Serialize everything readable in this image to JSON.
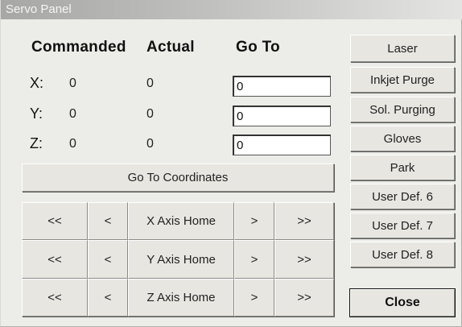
{
  "window": {
    "title": "Servo Panel"
  },
  "headers": {
    "commanded": "Commanded",
    "actual": "Actual",
    "goto": "Go To"
  },
  "axes": [
    {
      "label": "X:",
      "commanded": "0",
      "actual": "0",
      "goto": "0"
    },
    {
      "label": "Y:",
      "commanded": "0",
      "actual": "0",
      "goto": "0"
    },
    {
      "label": "Z:",
      "commanded": "0",
      "actual": "0",
      "goto": "0"
    }
  ],
  "go_to_coordinates_label": "Go To Coordinates",
  "jog": {
    "fast_neg": "<<",
    "slow_neg": "<",
    "slow_pos": ">",
    "fast_pos": ">>",
    "x_home": "X Axis Home",
    "y_home": "Y Axis Home",
    "z_home": "Z Axis Home"
  },
  "side_buttons": [
    "Laser",
    "Inkjet Purge",
    "Sol. Purging",
    "Gloves",
    "Park",
    "User Def. 6",
    "User Def. 7",
    "User Def. 8"
  ],
  "close_label": "Close"
}
